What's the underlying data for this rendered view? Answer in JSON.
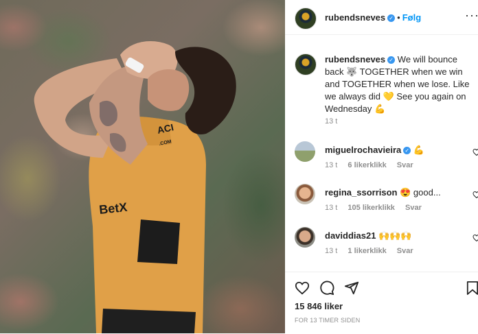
{
  "post": {
    "username": "rubendsneves",
    "follow_label": "Følg",
    "dot": "•",
    "caption_text": "We will bounce back 🐺 TOGETHER when we win and TOGETHER when we lose. Like we always did 💛 See you again on Wednesday 💪",
    "caption_time": "13 t",
    "likes": "15 846 liker",
    "time_ago": "FOR 13 TIMER SIDEN"
  },
  "photo": {
    "shirt_text_1": "ACI",
    "shirt_text_2": ".COM",
    "shirt_text_3": "BetX"
  },
  "comments": [
    {
      "username": "miguelrochavieira",
      "text": "💪",
      "time": "13 t",
      "likes": "6 likerklikk",
      "reply": "Svar",
      "verified": true
    },
    {
      "username": "regina_ssorrison",
      "text": "😍 good...",
      "time": "13 t",
      "likes": "105 likerklikk",
      "reply": "Svar",
      "verified": false
    },
    {
      "username": "daviddias21",
      "text": "🙌🙌🙌",
      "time": "13 t",
      "likes": "1 likerklikk",
      "reply": "Svar",
      "verified": false
    }
  ],
  "icons": {
    "verified": "verified-badge-icon",
    "verified_glyph": "✓",
    "more": "more-options-icon",
    "more_glyph": "···",
    "heart": "heart-icon",
    "comment": "comment-icon",
    "share": "share-icon",
    "save": "bookmark-icon"
  },
  "colors": {
    "accent": "#0095f6",
    "verified": "#3897f0",
    "muted": "#8e8e8e",
    "shirt": "#e0a048"
  }
}
